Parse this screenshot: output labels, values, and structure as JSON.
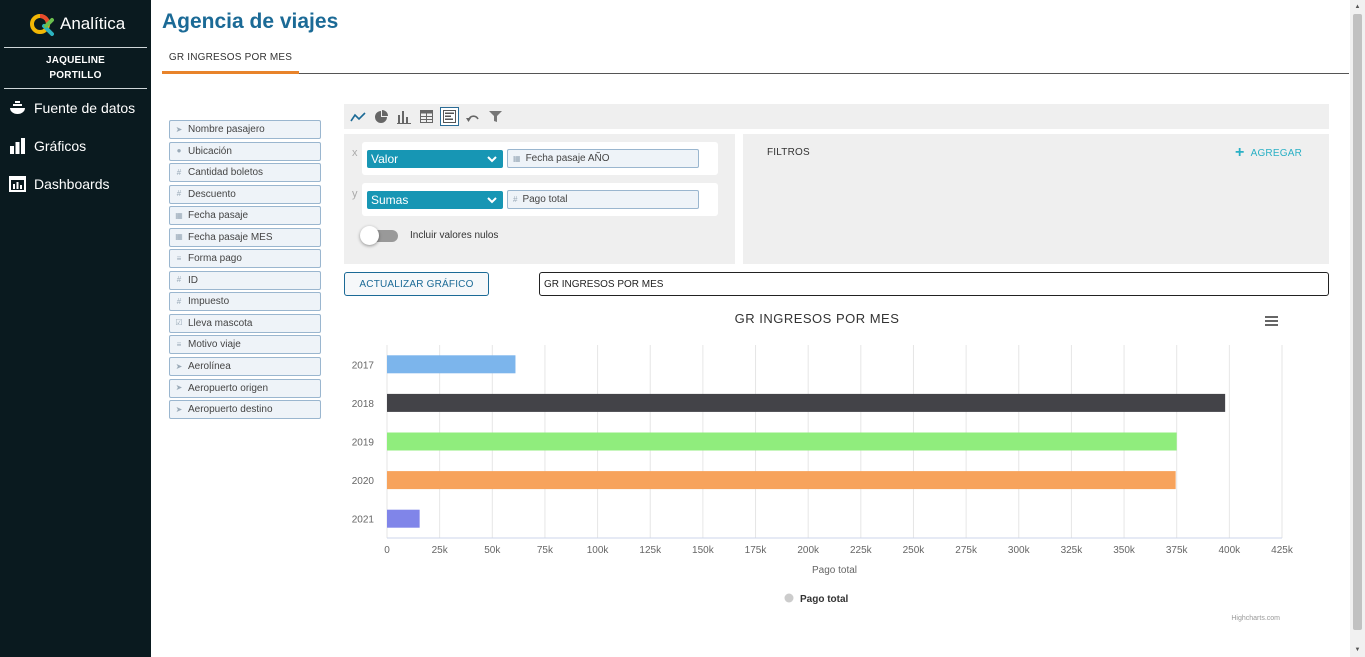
{
  "brand": {
    "name": "Analítica"
  },
  "user": {
    "line1": "JAQUELINE",
    "line2": "PORTILLO"
  },
  "nav": [
    {
      "label": "Fuente de datos",
      "icon": "bowl-icon"
    },
    {
      "label": "Gráficos",
      "icon": "bar-chart-icon"
    },
    {
      "label": "Dashboards",
      "icon": "dashboard-icon"
    }
  ],
  "page": {
    "title": "Agencia de viajes",
    "tab": "GR INGRESOS POR MES"
  },
  "fields": [
    {
      "label": "Nombre pasajero",
      "icon": "send-icon"
    },
    {
      "label": "Ubicación",
      "icon": "pin-icon"
    },
    {
      "label": "Cantidad boletos",
      "icon": "number-icon"
    },
    {
      "label": "Descuento",
      "icon": "number-icon"
    },
    {
      "label": "Fecha pasaje",
      "icon": "calendar-icon"
    },
    {
      "label": "Fecha pasaje MES",
      "icon": "calendar-icon"
    },
    {
      "label": "Forma pago",
      "icon": "list-icon"
    },
    {
      "label": "ID",
      "icon": "number-icon"
    },
    {
      "label": "Impuesto",
      "icon": "number-icon"
    },
    {
      "label": "Lleva mascota",
      "icon": "checkbox-icon"
    },
    {
      "label": "Motivo viaje",
      "icon": "list-icon"
    },
    {
      "label": "Aerolínea",
      "icon": "send-icon"
    },
    {
      "label": "Aeropuerto origen",
      "icon": "send-icon"
    },
    {
      "label": "Aeropuerto destino",
      "icon": "send-icon"
    }
  ],
  "axes": {
    "x": {
      "letter": "x",
      "agg": "Valor",
      "field": "Fecha pasaje AÑO"
    },
    "y": {
      "letter": "y",
      "agg": "Sumas",
      "field": "Pago total"
    },
    "nulls_label": "Incluir valores nulos"
  },
  "filters": {
    "label": "FILTROS",
    "add": "AGREGAR"
  },
  "update_button": "ACTUALIZAR GRÁFICO",
  "title_input_value": "GR INGRESOS POR MES",
  "chart_data": {
    "type": "bar",
    "orientation": "horizontal",
    "title": "GR INGRESOS POR MES",
    "categories": [
      "2017",
      "2018",
      "2019",
      "2020",
      "2021"
    ],
    "series": [
      {
        "name": "Pago total",
        "values": [
          61000,
          398000,
          375000,
          374500,
          15500
        ]
      }
    ],
    "bar_colors": [
      "#7cb5ec",
      "#434348",
      "#90ed7d",
      "#f7a35c",
      "#8085e9"
    ],
    "xlabel": "Pago total",
    "xlim": [
      0,
      425000
    ],
    "ticks": [
      "0",
      "25k",
      "50k",
      "75k",
      "100k",
      "125k",
      "150k",
      "175k",
      "200k",
      "225k",
      "250k",
      "275k",
      "300k",
      "325k",
      "350k",
      "375k",
      "400k",
      "425k"
    ],
    "tick_step": 25000,
    "grid": true,
    "legend": {
      "position": "bottom",
      "label": "Pago total"
    },
    "credits": "Highcharts.com"
  }
}
